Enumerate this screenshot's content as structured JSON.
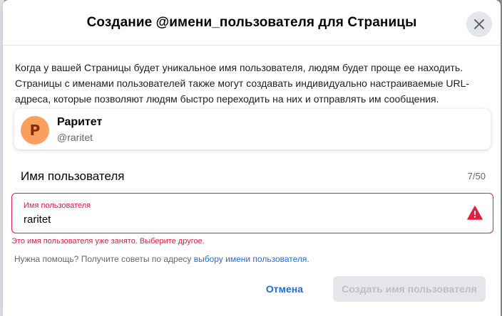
{
  "dialog": {
    "title": "Создание @имени_пользователя для Страницы",
    "close_icon": "close-icon"
  },
  "description": "Когда у вашей Страницы будет уникальное имя пользователя, людям будет проще ее находить. Страницы с именами пользователей также могут создавать индивидуально настраиваемые URL-адреса, которые позволяют людям быстро переходить на них и отправлять им сообщения.",
  "preview": {
    "avatar_letter": "P",
    "page_name": "Раритет",
    "handle": "@raritet"
  },
  "username_section": {
    "label": "Имя пользователя",
    "char_count": "7/50"
  },
  "username_input": {
    "floating_label": "Имя пользователя",
    "value": "raritet",
    "status_icon": "warning-icon"
  },
  "error_message": "Это имя пользователя уже занято. Выберите другое.",
  "help": {
    "prefix": "Нужна помощь? Получите советы по адресу ",
    "link": "выбору имени пользователя",
    "suffix": "."
  },
  "buttons": {
    "cancel": "Отмена",
    "create": "Создать имя пользователя"
  },
  "colors": {
    "accent": "#216fdb",
    "error": "#e41e3f",
    "avatar": "#f9a05f"
  }
}
